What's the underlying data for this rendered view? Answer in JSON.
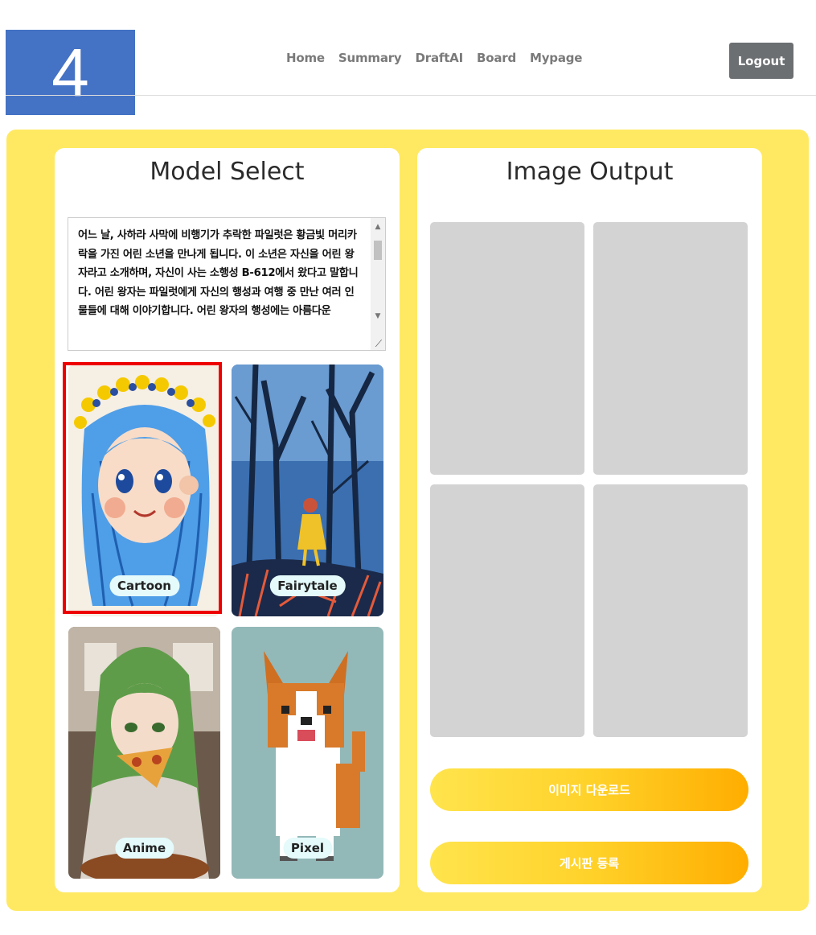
{
  "step_badge": "4",
  "nav": {
    "items": [
      "Home",
      "Summary",
      "DraftAI",
      "Board",
      "Mypage"
    ],
    "logout_label": "Logout"
  },
  "model_select": {
    "title": "Model Select",
    "story_text": "어느 날, 사하라 사막에 비행기가 추락한 파일럿은 황금빛 머리카락을 가진 어린 소년을 만나게 됩니다. 이 소년은 자신을 어린 왕자라고 소개하며, 자신이 사는 소행성 B-612에서 왔다고 말합니다. 어린 왕자는 파일럿에게 자신의 행성과 여행 중 만난 여러 인물들에 대해 이야기합니다. 어린 왕자의 행성에는 아름다운",
    "models": [
      {
        "label": "Cartoon",
        "icon": "cartoon-girl-thumbnail",
        "selected": true
      },
      {
        "label": "Fairytale",
        "icon": "forest-girl-thumbnail",
        "selected": false
      },
      {
        "label": "Anime",
        "icon": "anime-girl-pizza-thumbnail",
        "selected": false
      },
      {
        "label": "Pixel",
        "icon": "pixel-corgi-thumbnail",
        "selected": false
      }
    ]
  },
  "image_output": {
    "title": "Image Output",
    "download_label": "이미지 다운로드",
    "post_label": "게시판 등록"
  },
  "colors": {
    "panel_bg": "#ffe962",
    "step_badge": "#4472c4",
    "selection_border": "#ee0000",
    "button_gradient": [
      "#ffe44d",
      "#ffad00"
    ]
  }
}
